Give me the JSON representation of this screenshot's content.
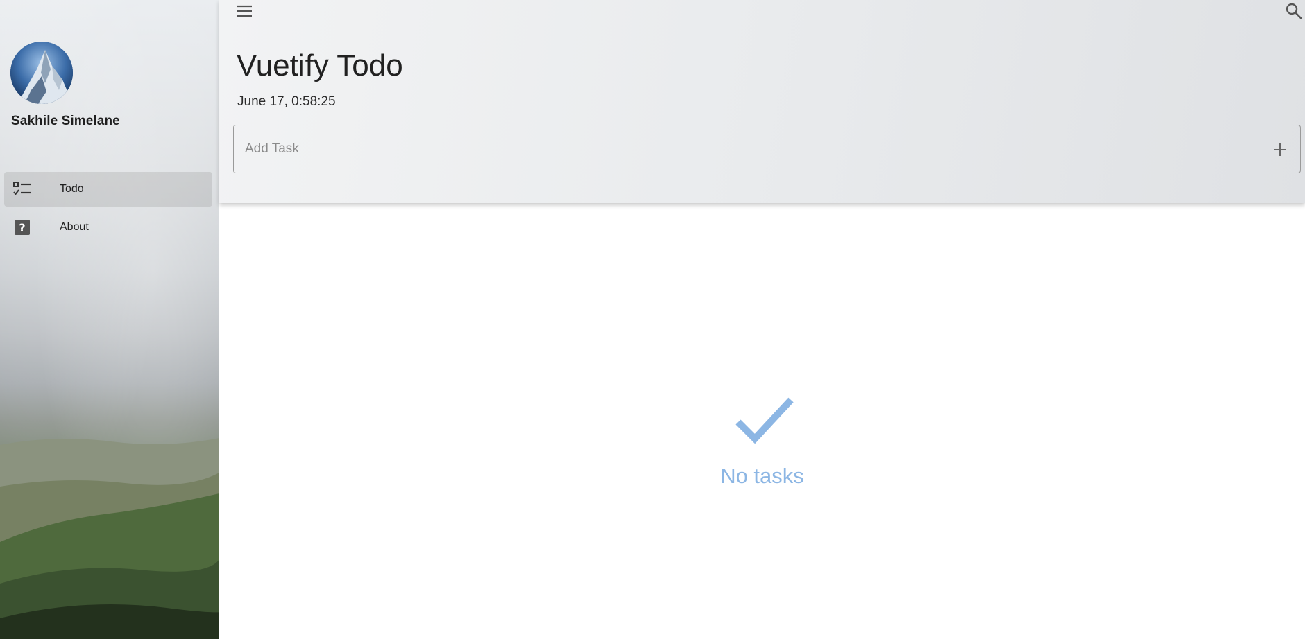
{
  "sidebar": {
    "user_name": "Sakhile Simelane",
    "items": [
      {
        "label": "Todo",
        "icon": "checklist-icon",
        "active": true
      },
      {
        "label": "About",
        "icon": "help-box-icon",
        "active": false
      }
    ]
  },
  "header": {
    "title": "Vuetify Todo",
    "date": "June 17, 0:58:25",
    "add_task_placeholder": "Add Task",
    "add_task_value": ""
  },
  "main": {
    "empty_text": "No tasks",
    "empty_icon": "check-icon"
  },
  "colors": {
    "accent": "#8cb6e4",
    "text": "#212121"
  }
}
